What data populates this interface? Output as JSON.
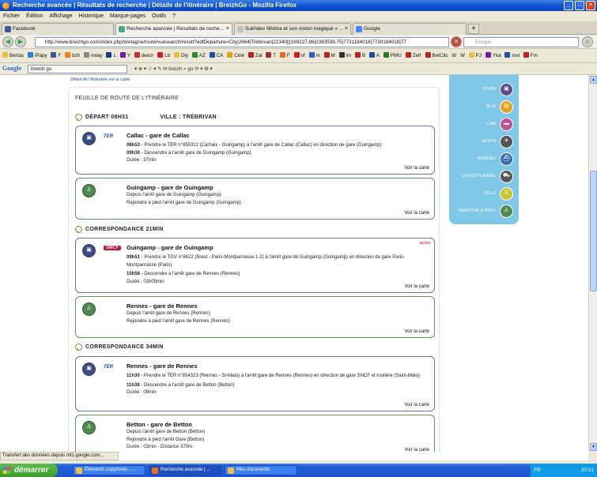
{
  "window": {
    "title": "Recherche avancée | Résultats de recherche | Détails de l'itinéraire | BreizhGo - Mozilla Firefox",
    "min": "_",
    "max": "□",
    "close": "×"
  },
  "menu": [
    "Fichier",
    "Édition",
    "Affichage",
    "Historique",
    "Marque-pages",
    "Outils",
    "?"
  ],
  "tabs": [
    {
      "label": "Facebook",
      "color": "#3b5998"
    },
    {
      "label": "Recherche avancée | Résultats de reche...",
      "color": "#e8e0c0"
    },
    {
      "label": "Sukhdev Mishra et son violon magique « ...",
      "color": "#c0c0c0"
    },
    {
      "label": "Google",
      "color": "#4285f4"
    }
  ],
  "tab_close": "×",
  "newtab": "+",
  "nav": {
    "back": "◀",
    "forward": "▶",
    "reload": "↻",
    "stop": "✕",
    "home": "⌂",
    "url": "http://www.breizhgo.com/index.php/bretagne/route/vuesearch/result?edtDeparture=City|2664|Trébrivan|22340|||169227,86|2383599,75|7731184018|7730184018|77",
    "search_placeholder": "Google"
  },
  "bookmarks": [
    "Bertas",
    "iPapy",
    "F",
    "bzh",
    "nway",
    "L",
    "Y",
    "deezr",
    "Lb",
    "Dly",
    "AZ",
    "CA",
    "Ciné",
    "Zal",
    "T",
    "F",
    "of",
    "m",
    "M",
    "im",
    "B",
    "A",
    "PMU",
    "Zefr",
    "BetClic",
    "W",
    "W",
    "PJ",
    "Yka",
    "mvi",
    "Fm"
  ],
  "gbar": {
    "logo": "Google",
    "query": "bretch go",
    "tools": "▾  ⊕ ▾  ☆ ▾  ✎  ✉  breizh  ⌕ go  ⟳  ▾  ⚙ ▾"
  },
  "page": {
    "top_link": "Détail de l'itinéraire sur la carte",
    "title": "FEUILLE DE ROUTE DE L'ITINÉRAIRE",
    "depart": "DÉPART 08H31",
    "ville": "VILLE : TRÉBRIVAN",
    "corr1": "CORRESPONDANCE  21MIN",
    "corr2": "CORRESPONDANCE  34MIN",
    "voir": "Voir la carte",
    "accs": "accès",
    "cards": [
      {
        "title": "Callac - gare de Callac",
        "logo": "TER",
        "l1a": "08h53",
        "l1b": " - Prendre le TER  n°855312  (Carhaix - Guingamp) à l'arrêt gare de Callac (Callac) en direction de gare (Guingamp)",
        "l2a": "09h30",
        "l2b": " - Descendre à l'arrêt gare de Guingamp (Guingamp)",
        "l3": "Durée : 37min"
      },
      {
        "title": "Guingamp - gare de Guingamp",
        "l1": "Depuis l'arrêt gare de Guingamp (Guingamp)",
        "l2": "Rejoindre à pied l'arrêt gare de Guingamp (Guingamp)"
      },
      {
        "title": "Guingamp - gare de Guingamp",
        "logo": "SNCF",
        "l1a": "09h51",
        "l1b": " - Prendre le TGV  n°8622  (Brest - Paris-Montparnasse 1-2) à l'arrêt gare de Guingamp (Guingamp) en direction de gare Paris-Montparnasse (Paris)",
        "l2a": "10h56",
        "l2b": " - Descendre à l'arrêt gare de Rennes (Rennes)",
        "l3": "Durée : 01h05min"
      },
      {
        "title": "Rennes - gare de Rennes",
        "l1": "Depuis l'arrêt gare de Rennes (Rennes)",
        "l2": "Rejoindre à pied l'arrêt gare de Rennes (Rennes)"
      },
      {
        "title": "Rennes - gare de Rennes",
        "logo": "TER",
        "l1a": "11h30",
        "l1b": " - Prendre le TER  n°854323  (Rennes - St-Malo) à l'arrêt gare de Rennes (Rennes) en direction de gare SNCF et routière (Saint-Malo)",
        "l2a": "11h38",
        "l2b": " - Descendre à l'arrêt gare de Betton (Betton)",
        "l3": "Durée : 08min"
      },
      {
        "title": "Betton - gare de Betton",
        "l1": "Depuis l'arrêt gare de Betton (Betton)",
        "l2": "Rejoindre à pied l'arrêt Gare (Betton)",
        "l3": "Durée : 03min - Distance  370m"
      }
    ],
    "modes": [
      "TRAIN",
      "BUS",
      "CAR",
      "AVION",
      "BATEAU",
      "COVOITURAGE",
      "VÉLO",
      "MARCHE À PIED"
    ]
  },
  "status": "Transfert des données depuis mt1.google.com...",
  "taskbar": {
    "start": "démarrer",
    "tasks": [
      "Éléments supprimés - ...",
      "Recherche avancée | ...",
      "Mes documents"
    ],
    "lang": "FR",
    "clock": "20:31"
  }
}
